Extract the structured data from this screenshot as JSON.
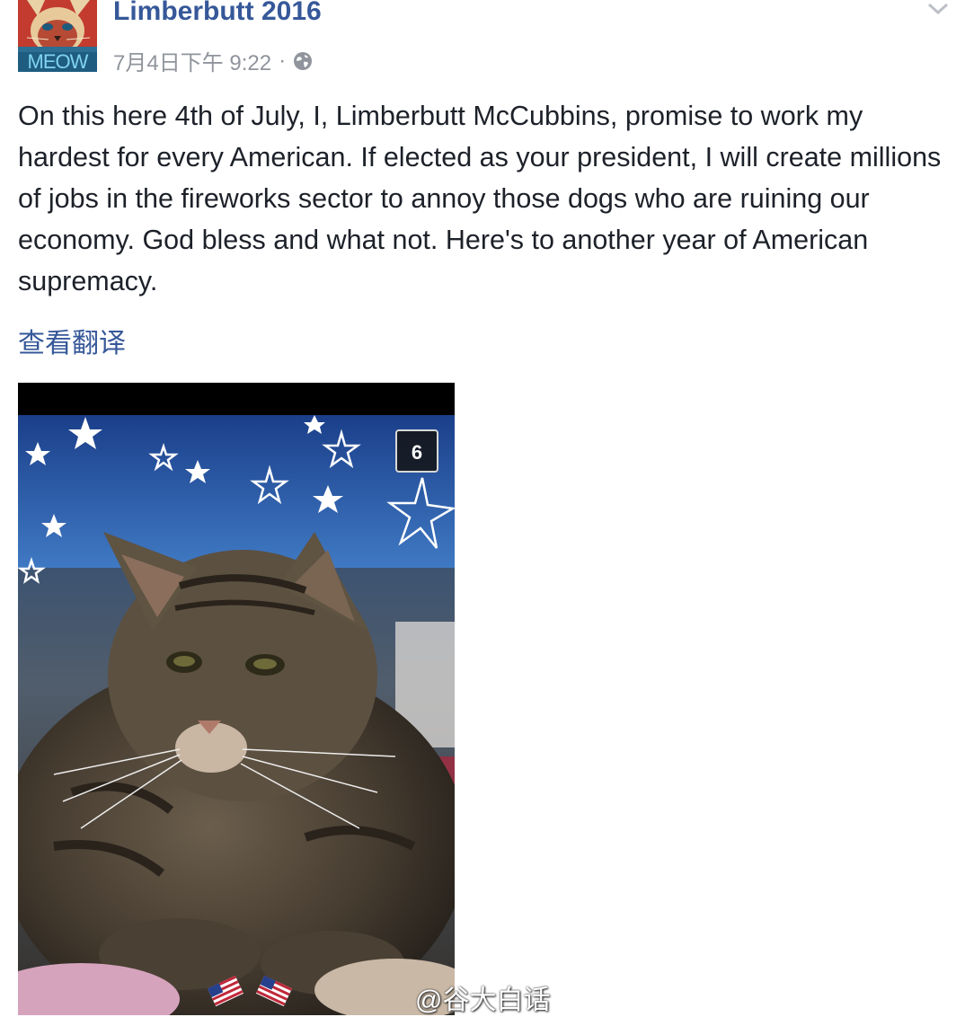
{
  "post": {
    "author": "Limberbutt 2016",
    "avatar_label": "MEOW",
    "timestamp": "7月4日下午 9:22",
    "separator": "·",
    "audience_icon": "globe-icon",
    "menu_icon": "chevron-down-icon",
    "text": "On this here 4th of July, I, Limberbutt McCubbins, promise to work my hardest for every American. If elected as your president, I will create millions of jobs in the fireworks sector to annoy those dogs who are ruining our economy. God bless and what not. Here's to another year of American supremacy.",
    "see_translation": "查看翻译",
    "photo": {
      "count_badge": "6",
      "decorations": [
        "star-icon",
        "us-flag-icon"
      ]
    },
    "watermark": "@谷大白话"
  },
  "colors": {
    "link": "#365899",
    "text": "#1d2129",
    "meta": "#90949c"
  }
}
